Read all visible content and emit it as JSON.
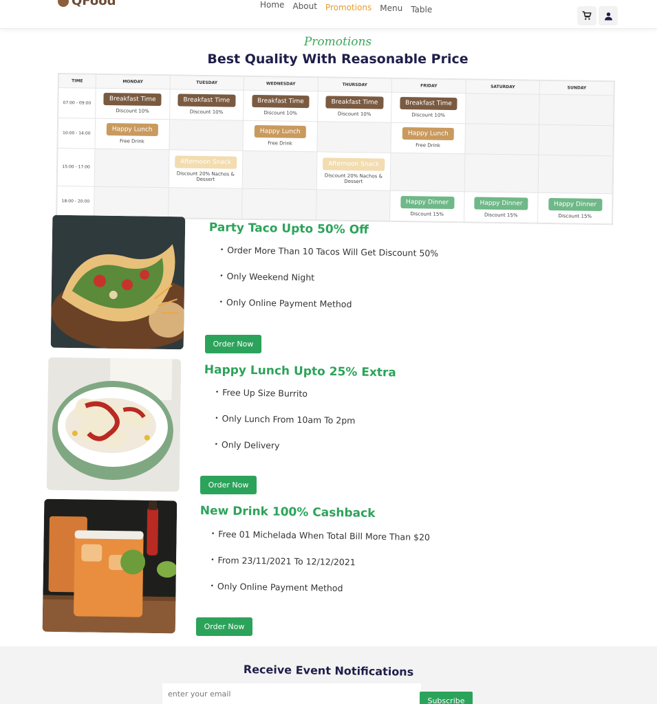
{
  "brand": {
    "name": "QFood"
  },
  "nav": {
    "links": [
      {
        "label": "Home",
        "active": false
      },
      {
        "label": "About",
        "active": false
      },
      {
        "label": "Promotions",
        "active": true
      },
      {
        "label": "Menu",
        "active": false
      },
      {
        "label": "Table",
        "active": false
      }
    ],
    "active_color": "#e89a2c",
    "cart_icon": "cart-icon",
    "user_icon": "user-icon"
  },
  "section": {
    "eyebrow": "Promotions",
    "title": "Best Quality With Reasonable Price"
  },
  "schedule": {
    "headers": [
      "TIME",
      "MONDAY",
      "TUESDAY",
      "WEDNESDAY",
      "THURSDAY",
      "FRIDAY",
      "SATURDAY",
      "SUNDAY"
    ],
    "rows": [
      {
        "time": "07:00 - 09:00",
        "cells": [
          {
            "label": "Breakfast Time",
            "note": "Discount 10%",
            "type": "breakfast"
          },
          {
            "label": "Breakfast Time",
            "note": "Discount 10%",
            "type": "breakfast"
          },
          {
            "label": "Breakfast Time",
            "note": "Discount 10%",
            "type": "breakfast"
          },
          {
            "label": "Breakfast Time",
            "note": "Discount 10%",
            "type": "breakfast"
          },
          {
            "label": "Breakfast Time",
            "note": "Discount 10%",
            "type": "breakfast"
          },
          null,
          null
        ]
      },
      {
        "time": "10:00 - 14:00",
        "cells": [
          {
            "label": "Happy Lunch",
            "note": "Free Drink",
            "type": "lunch"
          },
          null,
          {
            "label": "Happy Lunch",
            "note": "Free Drink",
            "type": "lunch"
          },
          null,
          {
            "label": "Happy Lunch",
            "note": "Free Drink",
            "type": "lunch"
          },
          null,
          null
        ]
      },
      {
        "time": "15:00 - 17:00",
        "cells": [
          null,
          {
            "label": "Afternoon Snack",
            "note": "Discount 20% Nachos & Dessert",
            "type": "snack"
          },
          null,
          {
            "label": "Afternoon Snack",
            "note": "Discount 20% Nachos & Dessert",
            "type": "snack"
          },
          null,
          null,
          null
        ]
      },
      {
        "time": "18:00 - 20:00",
        "cells": [
          null,
          null,
          null,
          null,
          {
            "label": "Happy Dinner",
            "note": "Discount 15%",
            "type": "dinner"
          },
          {
            "label": "Happy Dinner",
            "note": "Discount 15%",
            "type": "dinner"
          },
          {
            "label": "Happy Dinner",
            "note": "Discount 15%",
            "type": "dinner"
          }
        ]
      }
    ],
    "colors": {
      "breakfast": "#7a5a40",
      "lunch": "#c99a5e",
      "snack": "#f2dcb0",
      "dinner": "#6fb888"
    }
  },
  "promotions": [
    {
      "title": "Party Taco Upto 50% Off",
      "image": "taco-image",
      "bullets": [
        "Order More Than 10 Tacos Will Get Discount 50%",
        "Only Weekend Night",
        "Only Online Payment Method"
      ],
      "button": "Order Now"
    },
    {
      "title": "Happy Lunch Upto 25% Extra",
      "image": "burrito-image",
      "bullets": [
        "Free Up Size Burrito",
        "Only Lunch From 10am To 2pm",
        "Only Delivery"
      ],
      "button": "Order Now"
    },
    {
      "title": "New Drink 100% Cashback",
      "image": "drink-image",
      "bullets": [
        "Free 01 Michelada When Total Bill More Than $20",
        "From 23/11/2021 To 12/12/2021",
        "Only Online Payment Method"
      ],
      "button": "Order Now"
    }
  ],
  "accent_color": "#2ca35a",
  "newsletter": {
    "title": "Receive Event Notifications",
    "placeholder": "enter your email",
    "button": "Subscribe"
  }
}
